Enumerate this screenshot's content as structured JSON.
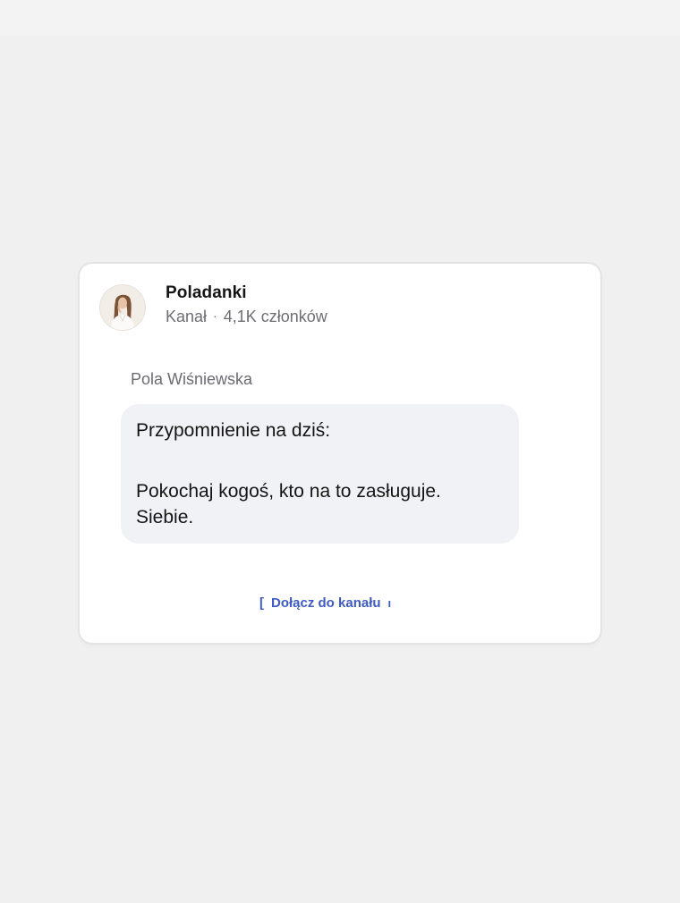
{
  "channel": {
    "name": "Poladanki",
    "type_label": "Kanał",
    "separator": "·",
    "members": "4,1K członków"
  },
  "message": {
    "sender": "Pola Wiśniewska",
    "lines": [
      "Przypomnienie na dziś:",
      "Pokochaj kogoś, kto na to zasługuje.",
      "Siebie."
    ]
  },
  "join_button": {
    "label": "Dołącz do kanału",
    "left_bracket": "[",
    "right_bracket": "ı"
  },
  "colors": {
    "background": "#f0f0f1",
    "card": "#ffffff",
    "bubble": "#f1f2f5",
    "accent": "#3e5bc4"
  }
}
